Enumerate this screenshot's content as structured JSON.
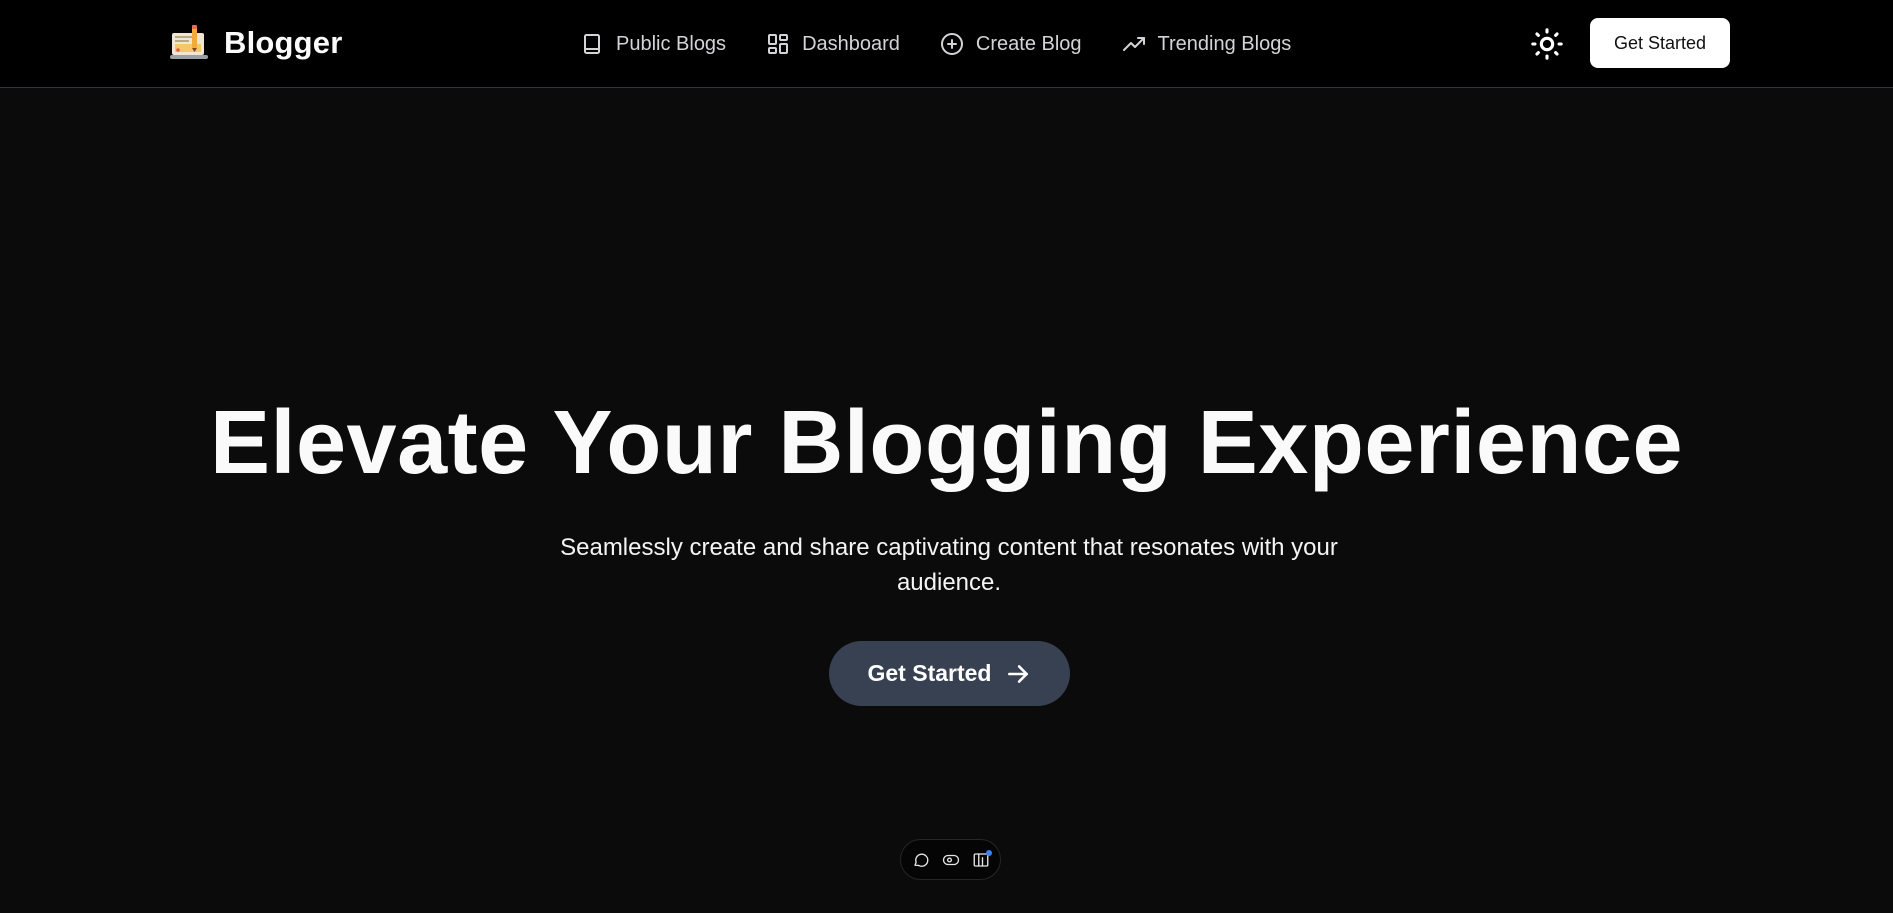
{
  "header": {
    "brand": {
      "name": "Blogger",
      "logo_icon": "laptop-pencil-icon"
    },
    "nav": [
      {
        "label": "Public Blogs",
        "icon": "book-icon"
      },
      {
        "label": "Dashboard",
        "icon": "layout-dashboard-icon"
      },
      {
        "label": "Create Blog",
        "icon": "plus-circle-icon"
      },
      {
        "label": "Trending Blogs",
        "icon": "trending-up-icon"
      }
    ],
    "theme_toggle_icon": "sun-icon",
    "cta_label": "Get Started"
  },
  "hero": {
    "title": "Elevate Your Blogging Experience",
    "subtitle": "Seamlessly create and share captivating content that resonates with your audience.",
    "cta_label": "Get Started",
    "cta_icon": "arrow-right-icon"
  },
  "dev_toolbar": {
    "items": [
      {
        "icon": "message-icon"
      },
      {
        "icon": "eye-toggle-icon"
      },
      {
        "icon": "panel-icon",
        "notification": true
      }
    ]
  },
  "colors": {
    "page_bg": "#0b0b0b",
    "header_bg": "#000000",
    "header_border": "#2f3441",
    "hero_button_bg": "#374151",
    "header_button_bg": "#ffffff",
    "notification_dot": "#3b82f6"
  }
}
